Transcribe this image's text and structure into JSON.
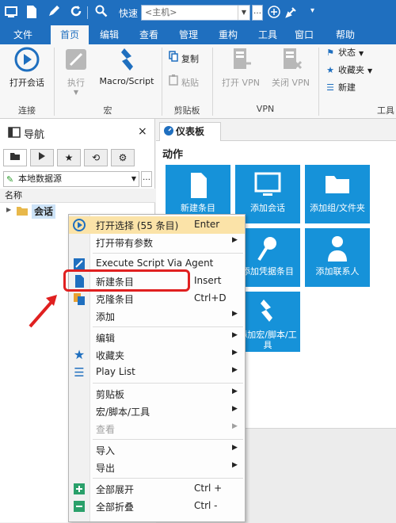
{
  "titlebar": {
    "quick_connect": "快速",
    "host_placeholder": "<主机>",
    "more": "…"
  },
  "ribbon_tabs": [
    "文件",
    "首页",
    "编辑",
    "查看",
    "管理",
    "重构",
    "工具",
    "窗口",
    "帮助"
  ],
  "ribbon": {
    "connect": {
      "open_session": "打开会话",
      "group": "连接"
    },
    "macro": {
      "execute": "执行",
      "macro_script": "Macro/Script",
      "group": "宏"
    },
    "clipboard": {
      "copy": "复制",
      "paste": "粘贴",
      "group": "剪贴板"
    },
    "vpn": {
      "open": "打开 VPN",
      "close": "关闭 VPN",
      "group": "VPN"
    },
    "tools": {
      "status": "状态",
      "favorites": "收藏夹",
      "new": "新建",
      "group": "工具"
    }
  },
  "nav": {
    "title": "导航",
    "close": "×",
    "datasource": "本地数据源",
    "column_header": "名称",
    "tree_item": "会话"
  },
  "dashboard": {
    "tab": "仪表板",
    "section_title": "动作",
    "tiles": [
      "新建条目",
      "添加会话",
      "添加组/文件夹",
      "添加凭据条目",
      "添加联系人",
      "添加宏/脚本/工具"
    ]
  },
  "context_menu": {
    "items": [
      {
        "label": "打开选择 (55 条目)",
        "shortcut": "Enter",
        "arrow": ""
      },
      {
        "label": "打开带有参数",
        "shortcut": "",
        "arrow": "▶"
      },
      {
        "label": "Execute Script Via Agent",
        "shortcut": "",
        "arrow": ""
      },
      {
        "label": "新建条目",
        "shortcut": "Insert",
        "arrow": ""
      },
      {
        "label": "克隆条目",
        "shortcut": "Ctrl+D",
        "arrow": ""
      },
      {
        "label": "添加",
        "shortcut": "",
        "arrow": "▶"
      },
      {
        "label": "编辑",
        "shortcut": "",
        "arrow": "▶"
      },
      {
        "label": "收藏夹",
        "shortcut": "",
        "arrow": "▶"
      },
      {
        "label": "Play List",
        "shortcut": "",
        "arrow": "▶"
      },
      {
        "label": "剪贴板",
        "shortcut": "",
        "arrow": "▶"
      },
      {
        "label": "宏/脚本/工具",
        "shortcut": "",
        "arrow": "▶"
      },
      {
        "label": "查看",
        "shortcut": "",
        "arrow": "▶"
      },
      {
        "label": "导入",
        "shortcut": "",
        "arrow": "▶"
      },
      {
        "label": "导出",
        "shortcut": "",
        "arrow": "▶"
      },
      {
        "label": "全部展开",
        "shortcut": "Ctrl +",
        "arrow": ""
      },
      {
        "label": "全部折叠",
        "shortcut": "Ctrl -",
        "arrow": ""
      }
    ]
  },
  "colors": {
    "accent": "#1f6fbf",
    "tile": "#1692d9",
    "highlight": "#fbe3a8",
    "annotation": "#e02020"
  }
}
